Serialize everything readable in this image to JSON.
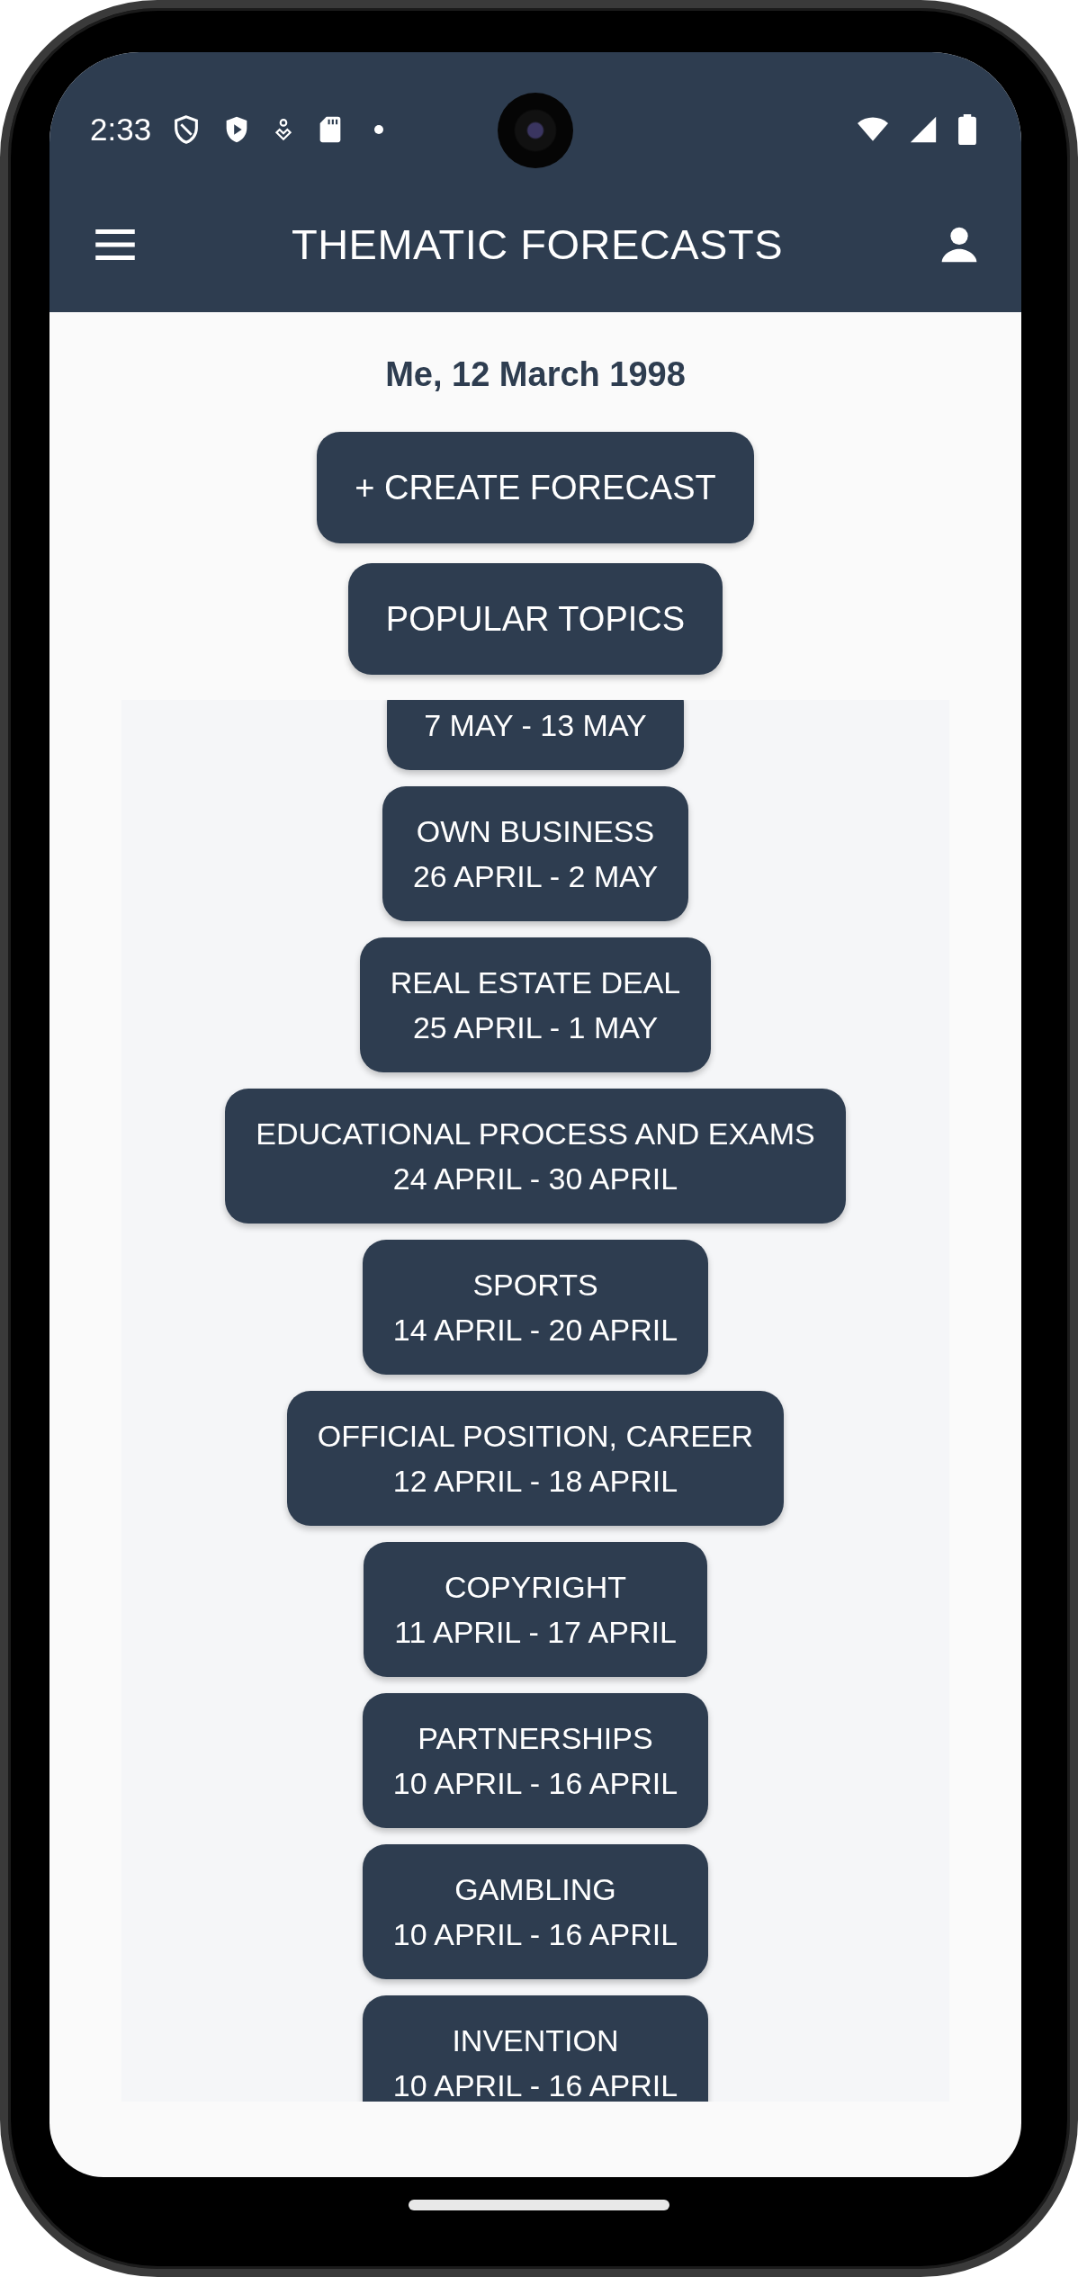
{
  "status_bar": {
    "time": "2:33"
  },
  "app_bar": {
    "title": "THEMATIC FORECASTS"
  },
  "date": "Me, 12 March 1998",
  "actions": [
    {
      "label": "+ CREATE FORECAST"
    },
    {
      "label": "POPULAR TOPICS"
    }
  ],
  "forecasts": [
    {
      "dates": "7 MAY - 13 MAY"
    },
    {
      "topic": "OWN BUSINESS",
      "dates": "26 APRIL - 2 MAY"
    },
    {
      "topic": "REAL ESTATE DEAL",
      "dates": "25 APRIL - 1 MAY"
    },
    {
      "topic": "EDUCATIONAL PROCESS AND EXAMS",
      "dates": "24 APRIL - 30 APRIL"
    },
    {
      "topic": "SPORTS",
      "dates": "14 APRIL - 20 APRIL"
    },
    {
      "topic": "OFFICIAL POSITION, CAREER",
      "dates": "12 APRIL - 18 APRIL"
    },
    {
      "topic": "COPYRIGHT",
      "dates": "11 APRIL - 17 APRIL"
    },
    {
      "topic": "PARTNERSHIPS",
      "dates": "10 APRIL - 16 APRIL"
    },
    {
      "topic": "GAMBLING",
      "dates": "10 APRIL - 16 APRIL"
    },
    {
      "topic": "INVENTION",
      "dates": "10 APRIL - 16 APRIL"
    }
  ]
}
